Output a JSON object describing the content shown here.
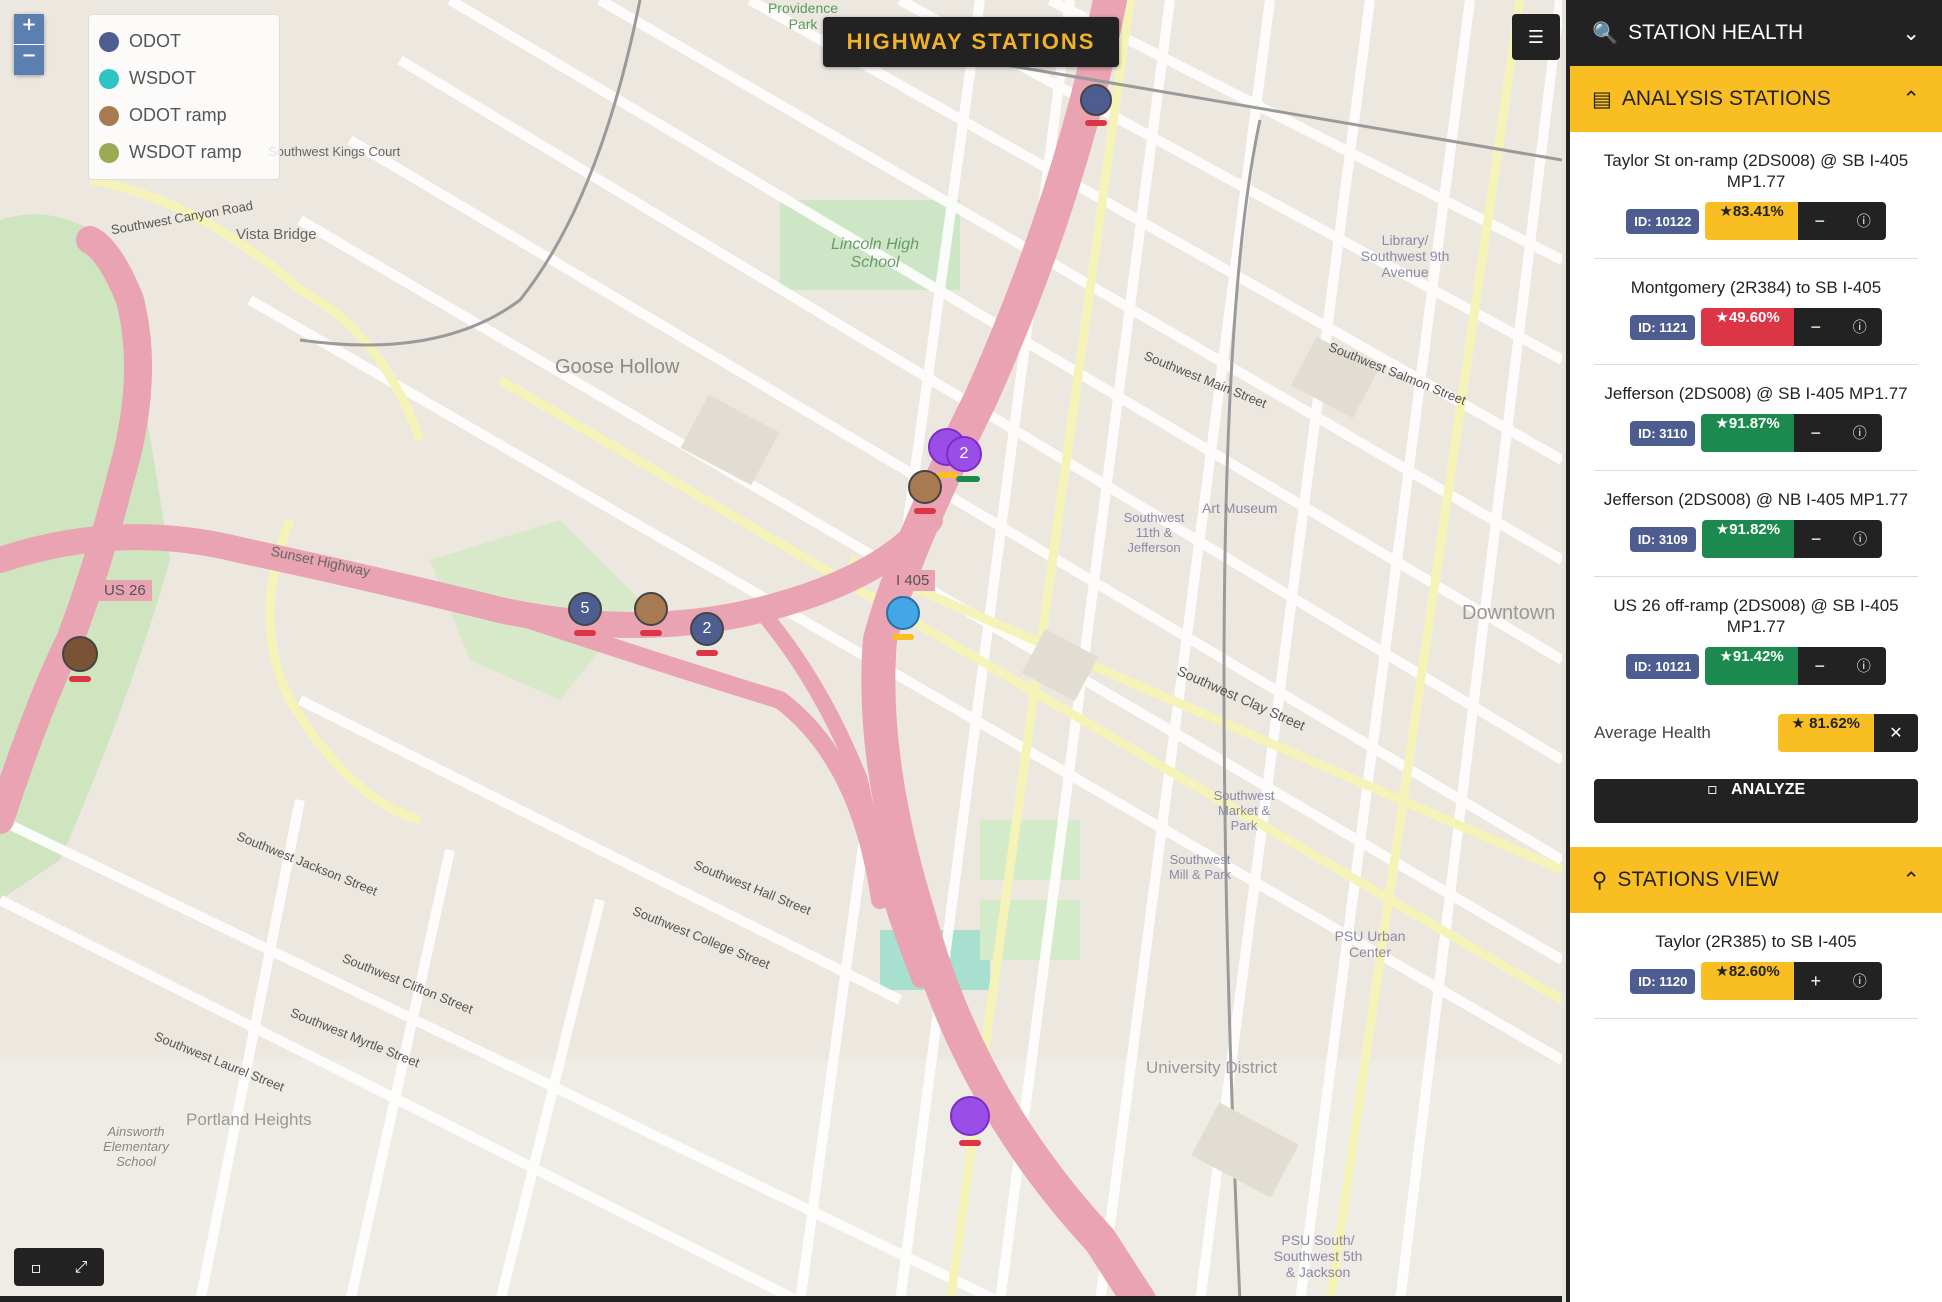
{
  "map": {
    "title": "HIGHWAY STATIONS",
    "zoom_in": "+",
    "zoom_out": "−",
    "legend": [
      {
        "label": "ODOT",
        "color": "#4e5d90"
      },
      {
        "label": "WSDOT",
        "color": "#2ec4c4"
      },
      {
        "label": "ODOT ramp",
        "color": "#a87a52"
      },
      {
        "label": "WSDOT ramp",
        "color": "#9aaa55"
      }
    ],
    "labels": {
      "goose_hollow": "Goose Hollow",
      "lincoln": "Lincoln High School",
      "portland_heights": "Portland Heights",
      "university_district": "University District",
      "downtown": "Downtown",
      "vista_bridge": "Vista Bridge",
      "sunset_highway": "Sunset Highway",
      "us26": "US 26",
      "i405": "I 405",
      "providence_park": "Providence Park",
      "art_museum": "Art Museum",
      "library": "Library/ Southwest 9th Avenue",
      "psu": "PSU Urban Center",
      "psu_south": "PSU South/ Southwest 5th & Jackson",
      "clay_street": "Southwest Clay Street",
      "jefferson": "Southwest 11th & Jefferson",
      "hall": "Southwest Hall Street",
      "college": "Southwest College Street",
      "jackson": "Southwest Jackson Street",
      "clifton": "Southwest Clifton Street",
      "kings_court": "Southwest Kings Court",
      "canyon_road": "Southwest Canyon Road",
      "main": "Southwest Main Street",
      "salmon": "Southwest Salmon Street",
      "ainsworth": "Ainsworth Elementary School",
      "laurel": "Southwest Laurel Street",
      "myrtle": "Southwest Myrtle Street",
      "market": "Southwest Market & Park",
      "mill": "Southwest Mill & Park"
    },
    "markers": {
      "m5": "5",
      "m2": "2",
      "m2b": "2",
      "m2c": "2"
    }
  },
  "panel": {
    "header": "STATION HEALTH",
    "analysis_title": "ANALYSIS STATIONS",
    "stations": [
      {
        "name": "Taylor St on-ramp (2DS008) @ SB I-405 MP1.77",
        "id": "ID: 10122",
        "pct": "83.41%",
        "status": "y"
      },
      {
        "name": "Montgomery (2R384) to SB I-405",
        "id": "ID: 1121",
        "pct": "49.60%",
        "status": "r"
      },
      {
        "name": "Jefferson (2DS008) @ SB I-405 MP1.77",
        "id": "ID: 3110",
        "pct": "91.87%",
        "status": "g"
      },
      {
        "name": "Jefferson (2DS008) @ NB I-405 MP1.77",
        "id": "ID: 3109",
        "pct": "91.82%",
        "status": "g"
      },
      {
        "name": "US 26 off-ramp (2DS008) @ SB I-405 MP1.77",
        "id": "ID: 10121",
        "pct": "91.42%",
        "status": "g"
      }
    ],
    "average_label": "Average Health",
    "average_value": "81.62%",
    "analyze_label": "ANALYZE",
    "view_title": "STATIONS VIEW",
    "view_station": {
      "name": "Taylor (2R385) to SB I-405",
      "id": "ID: 1120",
      "pct": "82.60%",
      "status": "y"
    }
  }
}
